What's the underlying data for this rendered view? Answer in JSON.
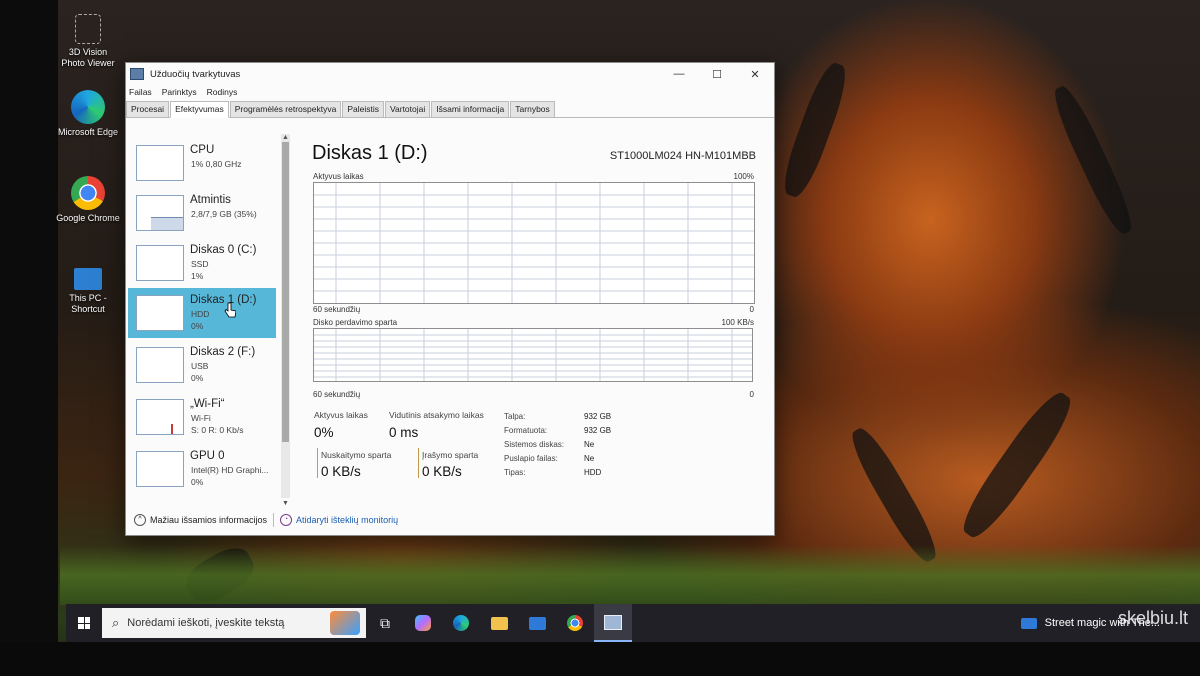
{
  "desktop": {
    "icons": [
      {
        "label": "3D Vision Photo Viewer",
        "icon": "photo-viewer-icon"
      },
      {
        "label": "Microsoft Edge",
        "icon": "edge-icon"
      },
      {
        "label": "Google Chrome",
        "icon": "chrome-icon"
      },
      {
        "label": "This PC - Shortcut",
        "icon": "this-pc-icon"
      }
    ]
  },
  "window": {
    "title": "Užduočių tvarkytuvas",
    "menu": [
      "Failas",
      "Parinktys",
      "Rodinys"
    ],
    "tabs": [
      "Procesai",
      "Efektyvumas",
      "Programėlės retrospektyva",
      "Paleistis",
      "Vartotojai",
      "Išsami informacija",
      "Tarnybos"
    ],
    "active_tab": "Efektyvumas"
  },
  "sidebar": {
    "items": [
      {
        "name": "CPU",
        "sub1": "1% 0,80 GHz",
        "sub2": ""
      },
      {
        "name": "Atmintis",
        "sub1": "2,8/7,9 GB (35%)",
        "sub2": ""
      },
      {
        "name": "Diskas 0 (C:)",
        "sub1": "SSD",
        "sub2": "1%"
      },
      {
        "name": "Diskas 1 (D:)",
        "sub1": "HDD",
        "sub2": "0%"
      },
      {
        "name": "Diskas 2 (F:)",
        "sub1": "USB",
        "sub2": "0%"
      },
      {
        "name": "„Wi-Fi“",
        "sub1": "Wi-Fi",
        "sub2": "S: 0 R: 0 Kb/s"
      },
      {
        "name": "GPU 0",
        "sub1": "Intel(R) HD Graphi...",
        "sub2": "0%"
      }
    ],
    "selected_index": 3
  },
  "main": {
    "title": "Diskas 1 (D:)",
    "model": "ST1000LM024 HN-M101MBB",
    "graph1": {
      "label": "Aktyvus laikas",
      "max": "100%",
      "xlabel": "60 sekundžių",
      "min": "0"
    },
    "graph2": {
      "label": "Disko perdavimo sparta",
      "max": "100 KB/s",
      "xlabel": "60 sekundžių",
      "min": "0"
    },
    "stats": {
      "active_label": "Aktyvus laikas",
      "active_value": "0%",
      "resp_label": "Vidutinis atsakymo laikas",
      "resp_value": "0 ms",
      "read_label": "Nuskaitymo sparta",
      "read_value": "0 KB/s",
      "write_label": "Įrašymo sparta",
      "write_value": "0 KB/s"
    },
    "props": [
      {
        "key": "Talpa:",
        "value": "932 GB"
      },
      {
        "key": "Formatuota:",
        "value": "932 GB"
      },
      {
        "key": "Sistemos diskas:",
        "value": "Ne"
      },
      {
        "key": "Puslapio failas:",
        "value": "Ne"
      },
      {
        "key": "Tipas:",
        "value": "HDD"
      }
    ]
  },
  "footer": {
    "fewer_details": "Mažiau išsamios informacijos",
    "open_monitor": "Atidaryti išteklių monitorių"
  },
  "taskbar": {
    "search_placeholder": "Norėdami ieškoti, įveskite tekstą",
    "news_text": "Street magic with The..."
  },
  "watermark": "skelbiu.lt"
}
